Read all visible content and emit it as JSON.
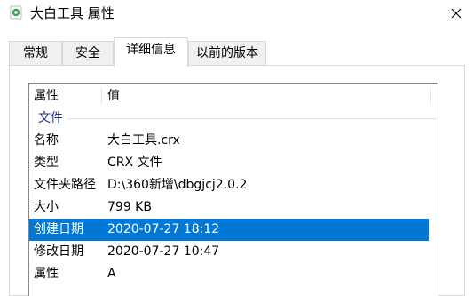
{
  "window": {
    "title": "大白工具 属性",
    "icon": "app-icon"
  },
  "tabs": [
    {
      "label": "常规",
      "active": false
    },
    {
      "label": "安全",
      "active": false
    },
    {
      "label": "详细信息",
      "active": true
    },
    {
      "label": "以前的版本",
      "active": false
    }
  ],
  "list": {
    "columns": {
      "name": "属性",
      "value": "值"
    },
    "group": "文件",
    "rows": [
      {
        "name": "名称",
        "value": "大白工具.crx",
        "selected": false
      },
      {
        "name": "类型",
        "value": "CRX 文件",
        "selected": false
      },
      {
        "name": "文件夹路径",
        "value": "D:\\360新增\\dbgjcj2.0.2",
        "selected": false
      },
      {
        "name": "大小",
        "value": "799 KB",
        "selected": false
      },
      {
        "name": "创建日期",
        "value": "2020-07-27 18:12",
        "selected": true
      },
      {
        "name": "修改日期",
        "value": "2020-07-27 10:47",
        "selected": false
      },
      {
        "name": "属性",
        "value": "A",
        "selected": false
      }
    ]
  },
  "colors": {
    "selection": "#0078d7",
    "group_header": "#1e3287",
    "border": "#828790"
  }
}
